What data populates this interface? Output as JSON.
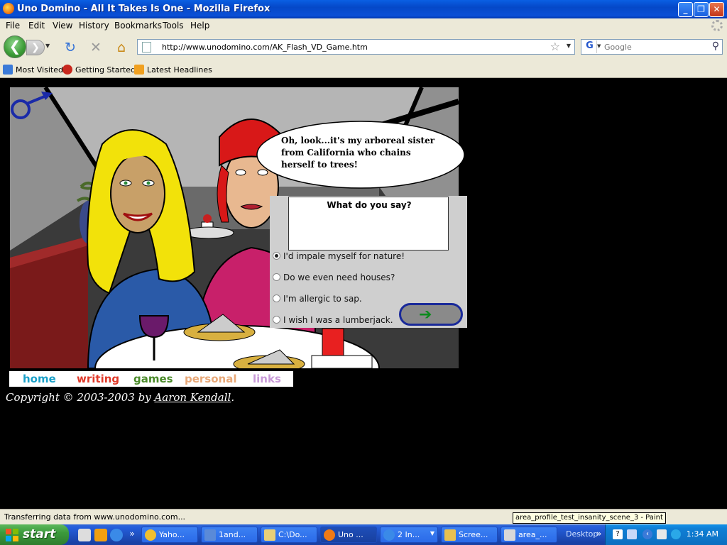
{
  "window": {
    "title": "Uno Domino - All It Takes Is One - Mozilla Firefox",
    "minimize": "_",
    "restore": "❐",
    "close": "✕"
  },
  "menu": [
    "File",
    "Edit",
    "View",
    "History",
    "Bookmarks",
    "Tools",
    "Help"
  ],
  "nav": {
    "url": "http://www.unodomino.com/AK_Flash_VD_Game.htm",
    "search_placeholder": "Google",
    "search_engine_letter": "G"
  },
  "bookmarks": [
    "Most Visited",
    "Getting Started",
    "Latest Headlines"
  ],
  "game": {
    "speech": "Oh, look...it's my arboreal sister from California who chains herself to trees!",
    "question": "What do you say?",
    "options": [
      "I'd impale myself for nature!",
      "Do we even need houses?",
      "I'm allergic to sap.",
      "I wish I was a lumberjack."
    ],
    "selected_option": 0
  },
  "site_links": {
    "home": "home",
    "writing": "writing",
    "games": "games",
    "personal": "personal",
    "links": "links",
    "colors": {
      "home": "#1aa0c8",
      "writing": "#e03a2a",
      "games": "#4a8a2a",
      "personal": "#e8a878",
      "links": "#c89ad8"
    }
  },
  "copyright": {
    "prefix": "Copyright © 2003-2003 by",
    "author": "Aaron Kendall",
    "suffix": "."
  },
  "status": {
    "text": "Transferring data from www.unodomino.com...",
    "tooltip": "area_profile_test_insanity_scene_3 - Paint"
  },
  "taskbar": {
    "start": "start",
    "tasks": [
      "Yaho...",
      "1and...",
      "C:\\Do...",
      "Uno ...",
      "2 In...",
      "Scree...",
      "area_..."
    ],
    "desktop": "Desktop",
    "clock": "1:34 AM"
  }
}
